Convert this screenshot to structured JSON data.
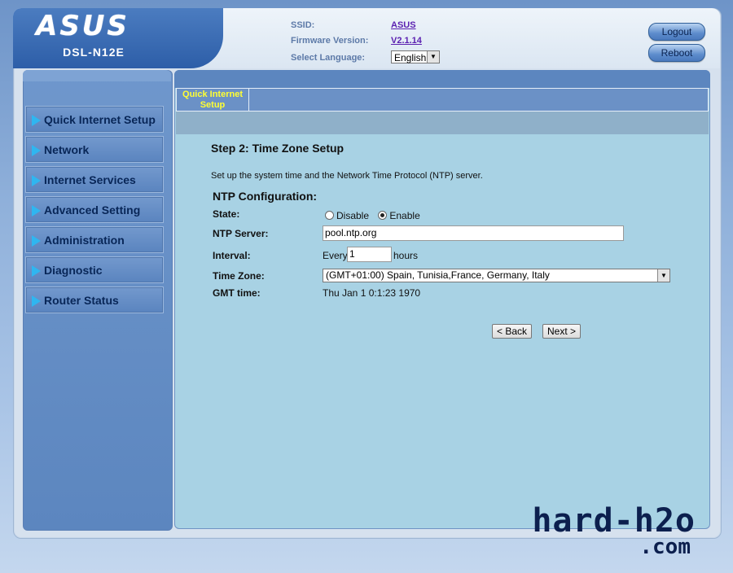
{
  "header": {
    "brand_logo": "ASUS",
    "model": "DSL-N12E",
    "ssid_label": "SSID:",
    "ssid_value": "ASUS",
    "firmware_label": "Firmware Version:",
    "firmware_value": "V2.1.14",
    "language_label": "Select Language:",
    "language_value": "English",
    "logout_label": "Logout",
    "reboot_label": "Reboot"
  },
  "sidebar": {
    "items": [
      {
        "label": "Quick Internet Setup"
      },
      {
        "label": "Network"
      },
      {
        "label": "Internet Services"
      },
      {
        "label": "Advanced Setting"
      },
      {
        "label": "Administration"
      },
      {
        "label": "Diagnostic"
      },
      {
        "label": "Router Status"
      }
    ]
  },
  "tabs": [
    {
      "label": "Quick Internet Setup",
      "active": true
    }
  ],
  "main": {
    "step_title": "Step 2: Time Zone Setup",
    "description": "Set up the system time and the Network Time Protocol (NTP) server.",
    "section_title": "NTP Configuration:",
    "state_label": "State:",
    "state_options": [
      "Disable",
      "Enable"
    ],
    "state_selected": "Enable",
    "ntp_server_label": "NTP Server:",
    "ntp_server_value": "pool.ntp.org",
    "interval_label": "Interval:",
    "interval_prefix": "Every",
    "interval_value": "1",
    "interval_unit": "hours",
    "timezone_label": "Time Zone:",
    "timezone_value": "(GMT+01:00) Spain, Tunisia,France, Germany, Italy",
    "gmt_label": "GMT time:",
    "gmt_value": "Thu Jan 1 0:1:23 1970",
    "back_label": "< Back",
    "next_label": "Next >"
  },
  "watermark": {
    "line1": "hard-h2o",
    "line2": ".com"
  },
  "colors": {
    "accent_blue": "#5c86bf",
    "content_bg": "#a8d2e4",
    "active_tab_text": "#ffff33",
    "nav_arrow": "#2fb6f0"
  }
}
